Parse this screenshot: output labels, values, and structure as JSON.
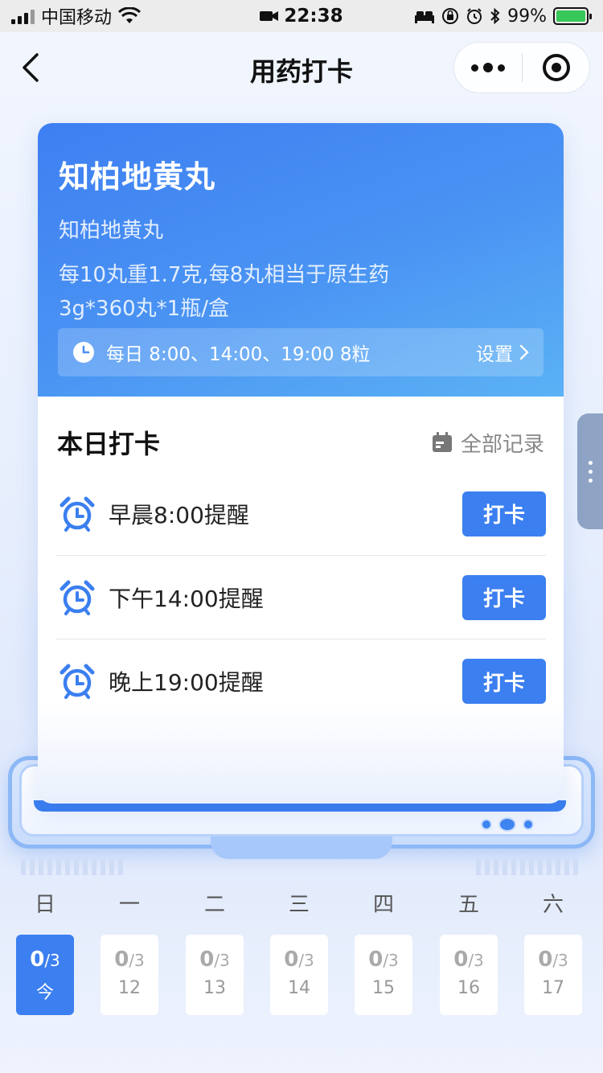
{
  "status_bar": {
    "carrier": "中国移动",
    "time": "22:38",
    "battery": "99%"
  },
  "nav": {
    "title": "用药打卡"
  },
  "medicine": {
    "name": "知柏地黄丸",
    "generic_name": "知柏地黄丸",
    "spec": "每10丸重1.7克,每8丸相当于原生药3g*360丸*1瓶/盒",
    "schedule": "每日 8:00、14:00、19:00 8粒",
    "settings_label": "设置"
  },
  "today": {
    "title": "本日打卡",
    "all_records_label": "全部记录",
    "reminders": [
      {
        "label": "早晨8:00提醒",
        "button": "打卡"
      },
      {
        "label": "下午14:00提醒",
        "button": "打卡"
      },
      {
        "label": "晚上19:00提醒",
        "button": "打卡"
      }
    ]
  },
  "week": {
    "weekdays": [
      "日",
      "一",
      "二",
      "三",
      "四",
      "五",
      "六"
    ],
    "days": [
      {
        "done": "0",
        "total": "/3",
        "label": "今",
        "active": true
      },
      {
        "done": "0",
        "total": "/3",
        "label": "12",
        "active": false
      },
      {
        "done": "0",
        "total": "/3",
        "label": "13",
        "active": false
      },
      {
        "done": "0",
        "total": "/3",
        "label": "14",
        "active": false
      },
      {
        "done": "0",
        "total": "/3",
        "label": "15",
        "active": false
      },
      {
        "done": "0",
        "total": "/3",
        "label": "16",
        "active": false
      },
      {
        "done": "0",
        "total": "/3",
        "label": "17",
        "active": false
      }
    ]
  },
  "colors": {
    "primary": "#3b7ff0",
    "header_gradient_start": "#3e7ff2",
    "header_gradient_end": "#5bb2f5"
  },
  "icons": {
    "back": "back-arrow-icon",
    "more": "more-dots-icon",
    "close_miniprogram": "target-circle-icon",
    "clock": "clock-icon",
    "chevron": "chevron-right-icon",
    "calendar": "calendar-icon",
    "alarm": "alarm-clock-icon"
  }
}
